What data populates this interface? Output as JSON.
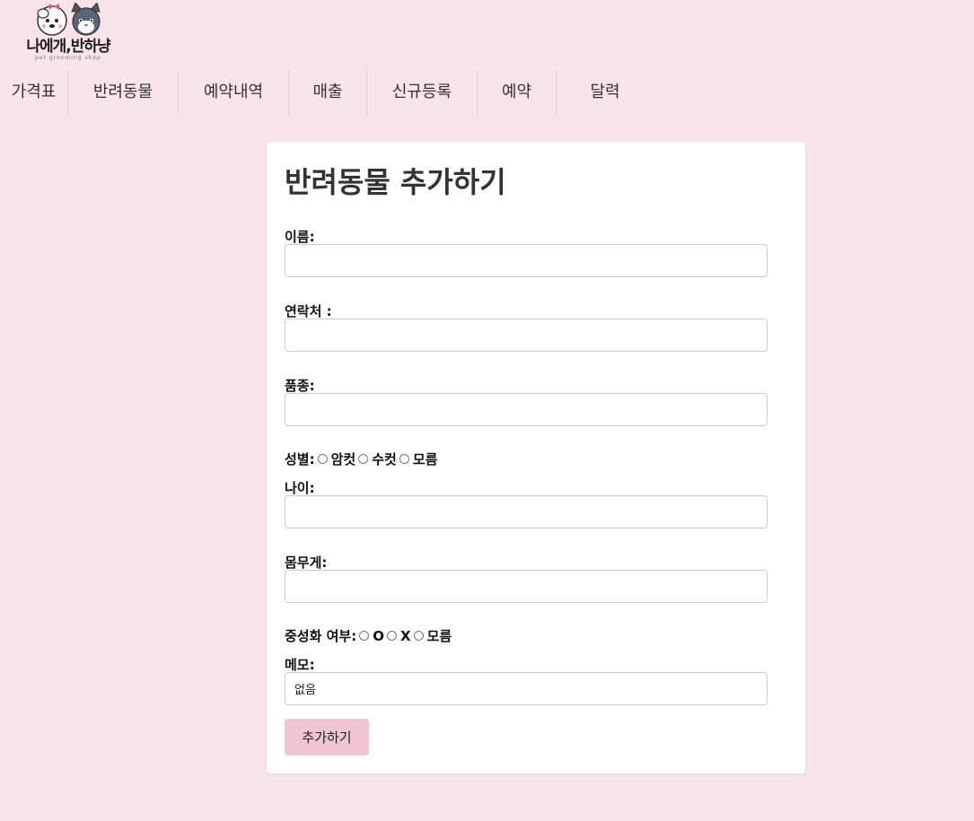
{
  "logo": {
    "text": "나에개,반하냥",
    "subtitle": "pet grooming shop"
  },
  "nav": {
    "items": [
      {
        "label": "가격표"
      },
      {
        "label": "반려동물"
      },
      {
        "label": "예약내역"
      },
      {
        "label": "매출"
      },
      {
        "label": "신규등록"
      },
      {
        "label": "예약"
      },
      {
        "label": "달력"
      }
    ]
  },
  "form": {
    "title": "반려동물 추가하기",
    "name_label": "이름:",
    "name_value": "",
    "contact_label": "연락처 :",
    "contact_value": "",
    "breed_label": "품종:",
    "breed_value": "",
    "gender": {
      "label": "성별:",
      "options": [
        "암컷",
        "수컷",
        "모름"
      ]
    },
    "age_label": "나이:",
    "age_value": "",
    "weight_label": "몸무게:",
    "weight_value": "",
    "neutered": {
      "label": "중성화 여부:",
      "options": [
        "O",
        "X",
        "모름"
      ]
    },
    "memo_label": "메모:",
    "memo_value": "없음",
    "submit_label": "추가하기"
  },
  "colors": {
    "background": "#f9e4ea",
    "button": "#f0c4d0",
    "card": "#ffffff"
  }
}
